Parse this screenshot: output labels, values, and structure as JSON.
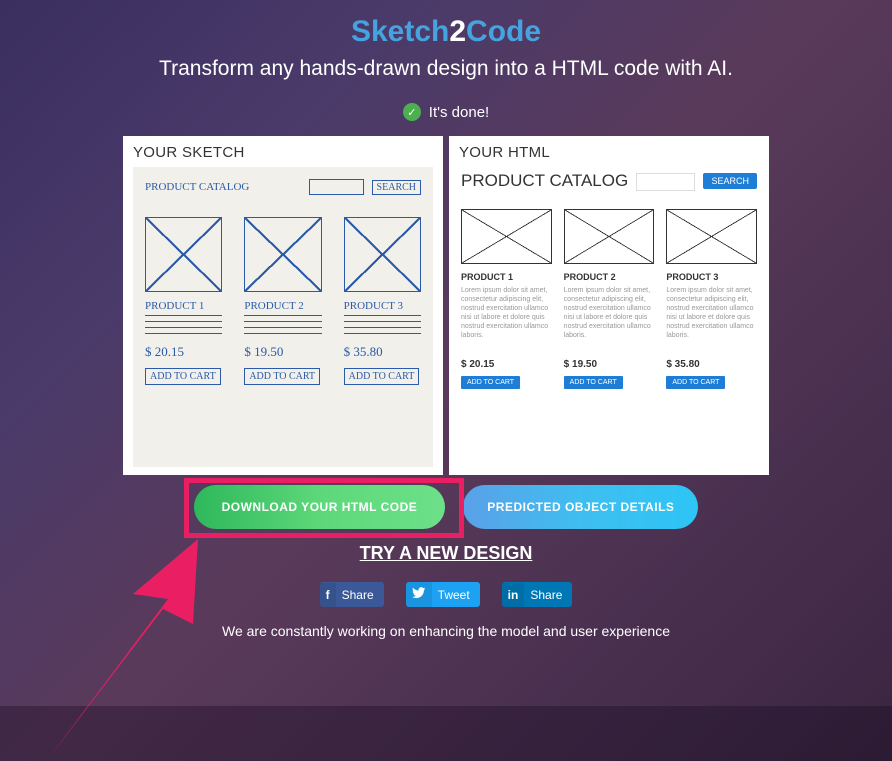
{
  "header": {
    "title_sketch": "Sketch",
    "title_2": "2",
    "title_code": "Code",
    "subtitle": "Transform any hands-drawn design into a HTML code with AI."
  },
  "status": {
    "text": "It's done!"
  },
  "sketch_panel": {
    "title": "YOUR SKETCH",
    "catalog_label": "PRODUCT CATALOG",
    "search_label": "SEARCH",
    "products": [
      {
        "name": "PRODUCT 1",
        "price": "$ 20.15",
        "cart": "ADD TO CART"
      },
      {
        "name": "PRODUCT 2",
        "price": "$ 19.50",
        "cart": "ADD TO CART"
      },
      {
        "name": "PRODUCT 3",
        "price": "$ 35.80",
        "cart": "ADD TO CART"
      }
    ]
  },
  "html_panel": {
    "title": "YOUR HTML",
    "catalog_label": "PRODUCT CATALOG",
    "search_label": "SEARCH",
    "lorem": "Lorem ipsum dolor sit amet, consectetur adipiscing elit, nostrud exercitation ullamco nisi ut labore et dolore quis nostrud exercitation ullamco laboris.",
    "products": [
      {
        "name": "PRODUCT 1",
        "price": "$ 20.15",
        "cart": "ADD TO CART"
      },
      {
        "name": "PRODUCT 2",
        "price": "$ 19.50",
        "cart": "ADD TO CART"
      },
      {
        "name": "PRODUCT 3",
        "price": "$ 35.80",
        "cart": "ADD TO CART"
      }
    ]
  },
  "buttons": {
    "download": "DOWNLOAD YOUR HTML CODE",
    "predict": "PREDICTED OBJECT DETAILS",
    "try_new": "TRY A NEW DESIGN"
  },
  "share": {
    "fb": "Share",
    "tw": "Tweet",
    "li": "Share"
  },
  "footer": "We are constantly working on enhancing the model and user experience",
  "annotation": {
    "highlight_color": "#e91e63",
    "arrow_color": "#e91e63"
  }
}
